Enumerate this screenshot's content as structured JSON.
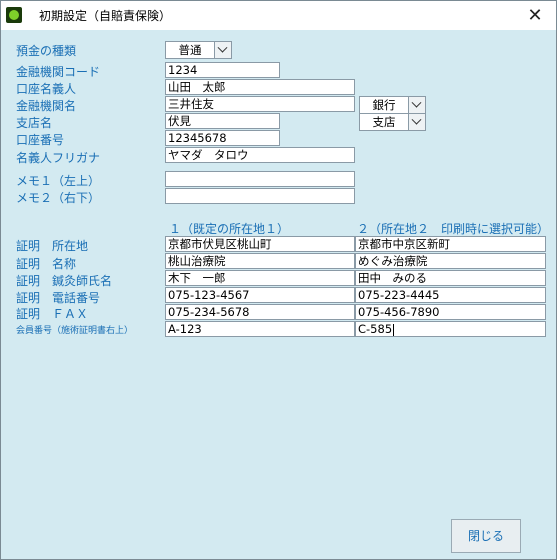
{
  "window": {
    "title": "初期設定（自賠責保険）",
    "close_glyph": "✕"
  },
  "bank": {
    "deposit_type_label": "預金の種類",
    "deposit_type_value": "普通",
    "bank_code_label": "金融機関コード",
    "bank_code_value": "1234",
    "account_holder_label": "口座名義人",
    "account_holder_value": "山田　太郎",
    "bank_name_label": "金融機関名",
    "bank_name_value": "三井住友",
    "bank_kind_value": "銀行",
    "branch_label": "支店名",
    "branch_value": "伏見",
    "branch_kind_value": "支店",
    "account_number_label": "口座番号",
    "account_number_value": "12345678",
    "holder_kana_label": "名義人フリガナ",
    "holder_kana_value": "ヤマダ　タロウ"
  },
  "memo": {
    "memo1_label": "メモ１（左上）",
    "memo1_value": "",
    "memo2_label": "メモ２（右下）",
    "memo2_value": ""
  },
  "cert": {
    "col1_header": "１（既定の所在地１）",
    "col2_header": "２（所在地２　印刷時に選択可能）",
    "rows": [
      {
        "label": "証明　所在地",
        "v1": "京都市伏見区桃山町",
        "v2": "京都市中京区新町"
      },
      {
        "label": "証明　名称",
        "v1": "桃山治療院",
        "v2": "めぐみ治療院"
      },
      {
        "label": "証明　鍼灸師氏名",
        "v1": "木下　一郎",
        "v2": "田中　みのる"
      },
      {
        "label": "証明　電話番号",
        "v1": "075-123-4567",
        "v2": "075-223-4445"
      },
      {
        "label": "証明　ＦＡＸ",
        "v1": "075-234-5678",
        "v2": "075-456-7890"
      },
      {
        "label": "会員番号（施術証明書右上）",
        "v1": "A-123",
        "v2": "C-585"
      }
    ]
  },
  "footer": {
    "close_label": "閉じる"
  }
}
